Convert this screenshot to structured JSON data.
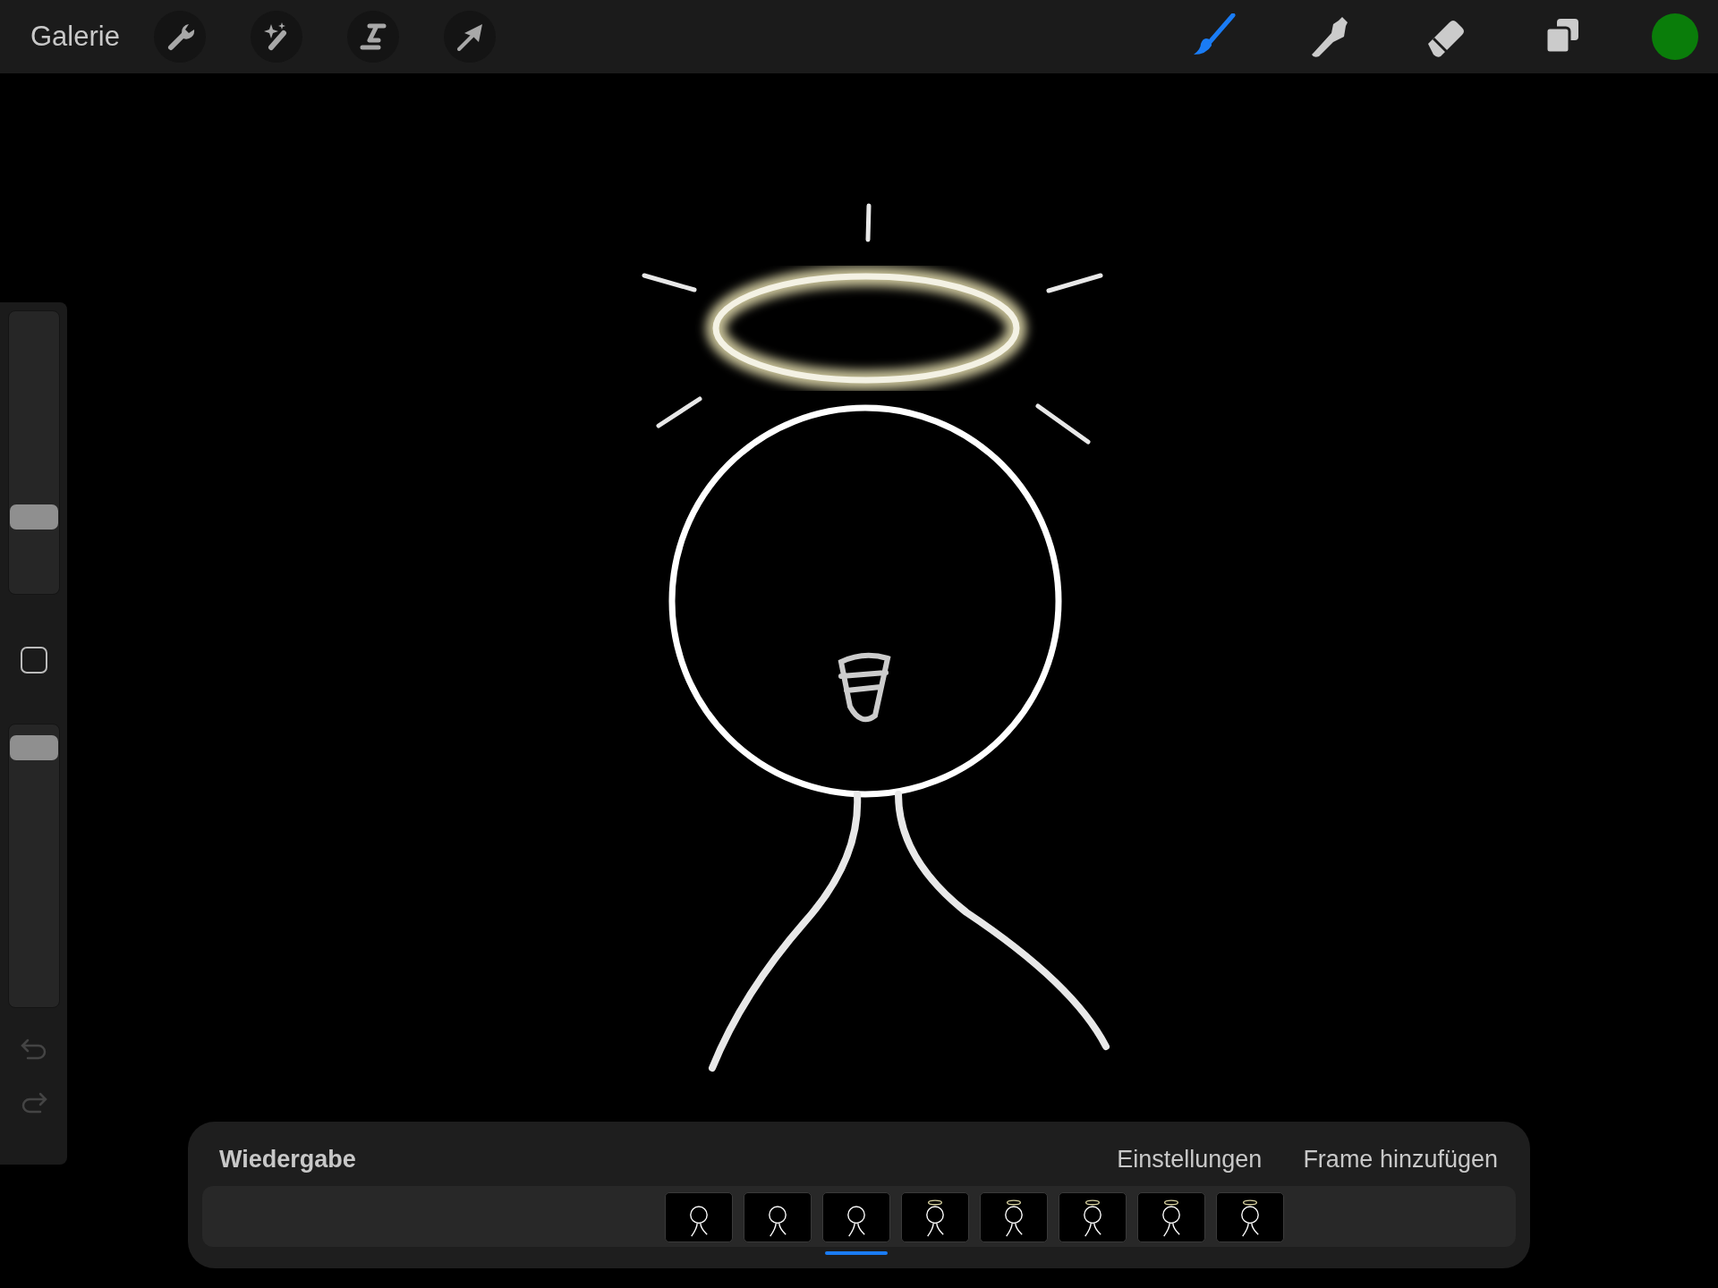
{
  "toolbar": {
    "gallery_label": "Galerie",
    "actions": [
      {
        "kind": "wrench"
      },
      {
        "kind": "wand"
      },
      {
        "kind": "selection"
      },
      {
        "kind": "transform"
      }
    ],
    "tools": [
      {
        "kind": "brush",
        "selected": true
      },
      {
        "kind": "smudge",
        "selected": false
      },
      {
        "kind": "eraser",
        "selected": false
      },
      {
        "kind": "layers",
        "selected": false
      }
    ],
    "color": "#0a7d0a"
  },
  "sidebar": {
    "size_slider": {
      "level": 0.25
    },
    "opacity_slider": {
      "level": 0.96
    }
  },
  "timeline": {
    "title": "Wiedergabe",
    "settings_label": "Einstellungen",
    "add_frame_label": "Frame hinzufügen",
    "frames": [
      {
        "halo": false,
        "selected": false
      },
      {
        "halo": false,
        "selected": false
      },
      {
        "halo": false,
        "selected": true
      },
      {
        "halo": true,
        "selected": false
      },
      {
        "halo": true,
        "selected": false
      },
      {
        "halo": true,
        "selected": false
      },
      {
        "halo": true,
        "selected": false
      },
      {
        "halo": true,
        "selected": false
      }
    ]
  }
}
